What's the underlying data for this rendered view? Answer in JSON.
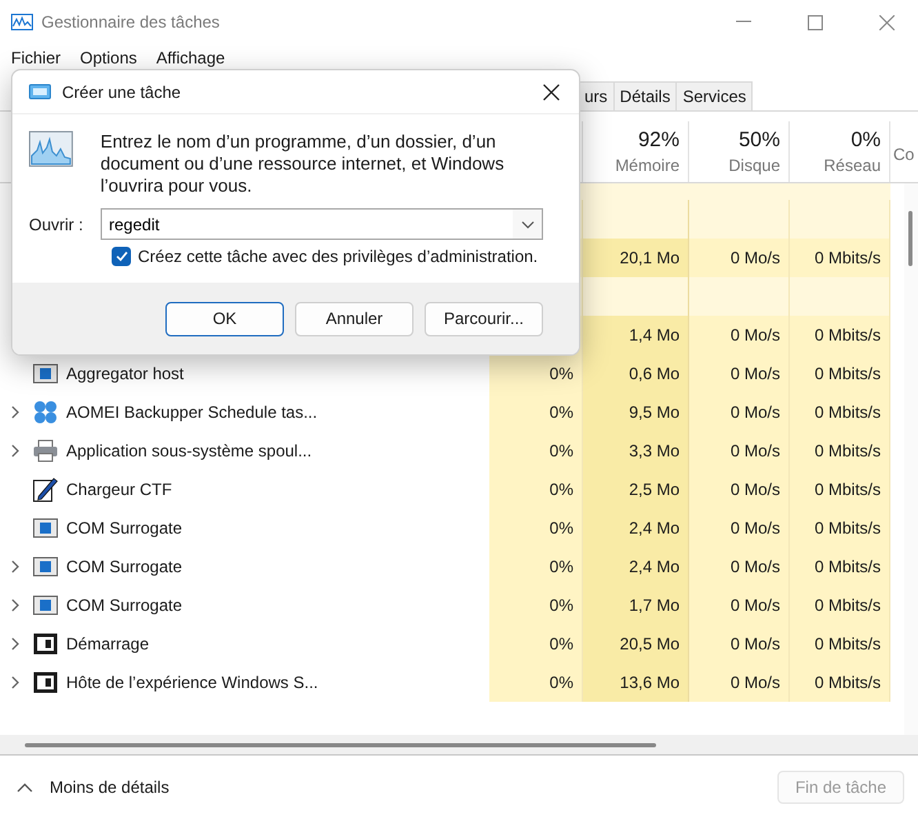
{
  "window": {
    "title": "Gestionnaire des tâches"
  },
  "menu": [
    "Fichier",
    "Options",
    "Affichage"
  ],
  "tabs": [
    {
      "label": "urs",
      "selected": false
    },
    {
      "label": "Détails",
      "selected": false
    },
    {
      "label": "Services",
      "selected": false
    }
  ],
  "columns": [
    {
      "percent": "92%",
      "label": "Mémoire"
    },
    {
      "percent": "50%",
      "label": "Disque"
    },
    {
      "percent": "0%",
      "label": "Réseau"
    },
    {
      "label": "Co"
    }
  ],
  "rows": [
    {
      "kind": "spacer"
    },
    {
      "kind": "covered",
      "memory": "20,1 Mo",
      "disk": "0 Mo/s",
      "network": "0 Mbits/s"
    },
    {
      "kind": "spacer"
    },
    {
      "kind": "covered",
      "memory": "1,4 Mo",
      "disk": "0 Mo/s",
      "network": "0 Mbits/s"
    },
    {
      "kind": "blue-window",
      "expandable": false,
      "name": "Aggregator host",
      "cpu": "0%",
      "memory": "0,6 Mo",
      "disk": "0 Mo/s",
      "network": "0 Mbits/s"
    },
    {
      "kind": "clover",
      "expandable": true,
      "name": "AOMEI Backupper Schedule tas...",
      "cpu": "0%",
      "memory": "9,5 Mo",
      "disk": "0 Mo/s",
      "network": "0 Mbits/s"
    },
    {
      "kind": "printer",
      "expandable": true,
      "name": "Application sous-système spoul...",
      "cpu": "0%",
      "memory": "3,3 Mo",
      "disk": "0 Mo/s",
      "network": "0 Mbits/s"
    },
    {
      "kind": "pen",
      "expandable": false,
      "name": "Chargeur CTF",
      "cpu": "0%",
      "memory": "2,5 Mo",
      "disk": "0 Mo/s",
      "network": "0 Mbits/s"
    },
    {
      "kind": "blue-window",
      "expandable": false,
      "name": "COM Surrogate",
      "cpu": "0%",
      "memory": "2,4 Mo",
      "disk": "0 Mo/s",
      "network": "0 Mbits/s"
    },
    {
      "kind": "blue-window",
      "expandable": true,
      "name": "COM Surrogate",
      "cpu": "0%",
      "memory": "2,4 Mo",
      "disk": "0 Mo/s",
      "network": "0 Mbits/s"
    },
    {
      "kind": "blue-window",
      "expandable": true,
      "name": "COM Surrogate",
      "cpu": "0%",
      "memory": "1,7 Mo",
      "disk": "0 Mo/s",
      "network": "0 Mbits/s"
    },
    {
      "kind": "dark-window",
      "expandable": true,
      "name": "Démarrage",
      "cpu": "0%",
      "memory": "20,5 Mo",
      "disk": "0 Mo/s",
      "network": "0 Mbits/s"
    },
    {
      "kind": "dark-window",
      "expandable": true,
      "name": "Hôte de l’expérience Windows S...",
      "cpu": "0%",
      "memory": "13,6 Mo",
      "disk": "0 Mo/s",
      "network": "0 Mbits/s"
    }
  ],
  "footer": {
    "toggle": "Moins de détails",
    "end_task": {
      "label": "Fin de tâche",
      "disabled": true
    }
  },
  "dialog": {
    "title": "Créer une tâche",
    "message": "Entrez le nom d’un programme, d’un dossier, d’un document ou d’une ressource internet, et Windows l’ouvrira pour vous.",
    "open_label": "Ouvrir :",
    "open_value": "regedit",
    "admin": {
      "label": "Créez cette tâche avec des privilèges d’administration.",
      "checked": true
    },
    "buttons": [
      {
        "label": "OK",
        "default": true
      },
      {
        "label": "Annuler",
        "default": false
      },
      {
        "label": "Parcourir...",
        "default": false
      }
    ]
  }
}
